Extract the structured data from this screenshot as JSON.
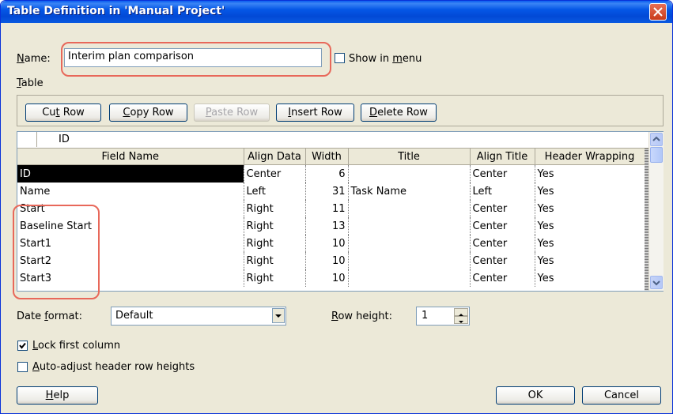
{
  "window": {
    "title": "Table Definition in 'Manual Project'"
  },
  "name_field": {
    "label_prefix": "N",
    "label_rest": "ame:",
    "value": "Interim plan comparison"
  },
  "show_in_menu": {
    "label_prefix": "Show in ",
    "label_hotkey": "m",
    "label_rest": "enu",
    "checked": false
  },
  "table_section": {
    "label_hotkey": "T",
    "label_rest": "able"
  },
  "toolbar": {
    "cut_row": {
      "pre": "Cu",
      "hot": "t",
      "post": " Row"
    },
    "copy_row": {
      "pre": "",
      "hot": "C",
      "post": "opy Row"
    },
    "paste_row": {
      "pre": "",
      "hot": "P",
      "post": "aste Row"
    },
    "insert_row": {
      "pre": "",
      "hot": "I",
      "post": "nsert Row"
    },
    "delete_row": {
      "pre": "",
      "hot": "D",
      "post": "elete Row"
    }
  },
  "edit_bar": {
    "value": "ID"
  },
  "grid": {
    "columns": [
      "Field Name",
      "Align Data",
      "Width",
      "Title",
      "Align Title",
      "Header Wrapping"
    ],
    "rows": [
      {
        "field": "ID",
        "align": "Center",
        "width": "6",
        "title": "",
        "align_title": "Center",
        "wrap": "Yes"
      },
      {
        "field": "Name",
        "align": "Left",
        "width": "31",
        "title": "Task Name",
        "align_title": "Left",
        "wrap": "Yes"
      },
      {
        "field": "Start",
        "align": "Right",
        "width": "11",
        "title": "",
        "align_title": "Center",
        "wrap": "Yes"
      },
      {
        "field": "Baseline Start",
        "align": "Right",
        "width": "13",
        "title": "",
        "align_title": "Center",
        "wrap": "Yes"
      },
      {
        "field": "Start1",
        "align": "Right",
        "width": "10",
        "title": "",
        "align_title": "Center",
        "wrap": "Yes"
      },
      {
        "field": "Start2",
        "align": "Right",
        "width": "10",
        "title": "",
        "align_title": "Center",
        "wrap": "Yes"
      },
      {
        "field": "Start3",
        "align": "Right",
        "width": "10",
        "title": "",
        "align_title": "Center",
        "wrap": "Yes"
      }
    ]
  },
  "date_format": {
    "label_pre": "Date ",
    "label_hot": "f",
    "label_post": "ormat:",
    "value": "Default"
  },
  "row_height": {
    "label_hot": "R",
    "label_post": "ow height:",
    "value": "1"
  },
  "lock_first_column": {
    "label_hot": "L",
    "label_post": "ock first column",
    "checked": true
  },
  "auto_adjust": {
    "label_hot": "A",
    "label_post": "uto-adjust header row heights",
    "checked": false
  },
  "buttons": {
    "help": {
      "hot": "H",
      "post": "elp"
    },
    "ok": "OK",
    "cancel": "Cancel"
  },
  "colors": {
    "highlight": "#e8685a",
    "titlebar": "#0249d6"
  }
}
